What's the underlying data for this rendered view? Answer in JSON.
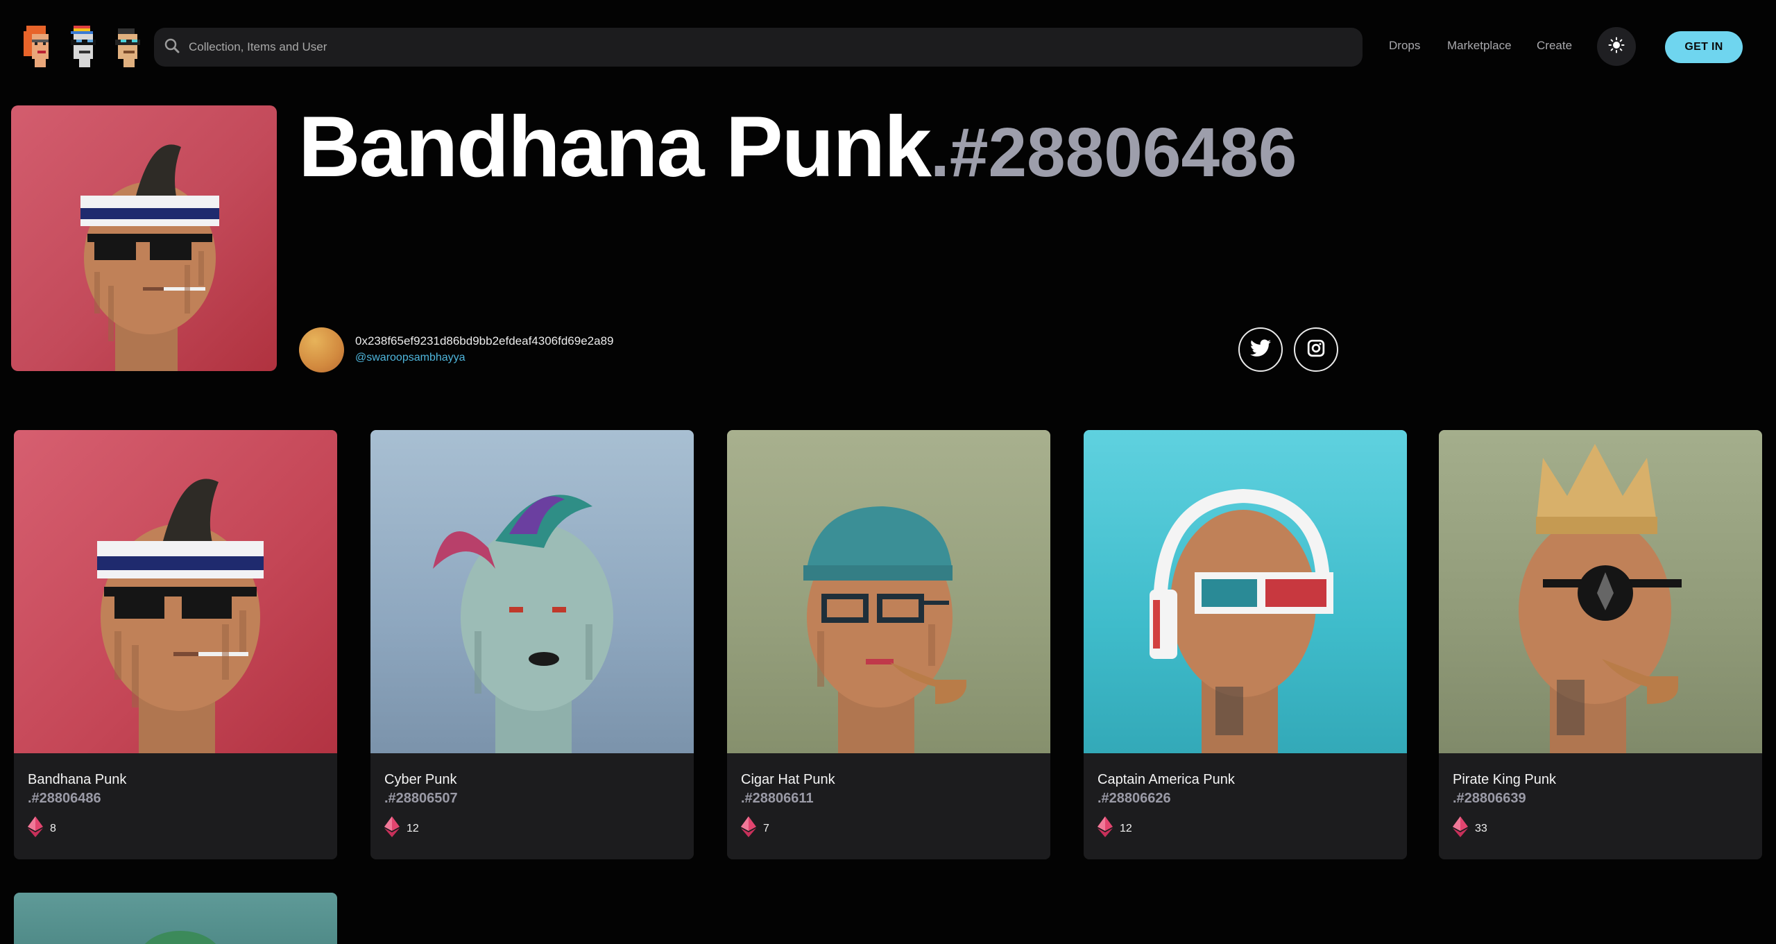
{
  "header": {
    "logos": [
      "punk-logo-orange",
      "punk-logo-cap",
      "punk-logo-shades"
    ],
    "search_placeholder": "Collection, Items and User",
    "nav": [
      "Drops",
      "Marketplace",
      "Create"
    ],
    "theme_icon": "sun-icon",
    "get_in_label": "GET IN"
  },
  "hero": {
    "name": "Bandhana Punk",
    "dot": ".",
    "number": "#28806486",
    "owner_address": "0x238f65ef9231d86bd9bb2efdeaf4306fd69e2a89",
    "owner_handle": "@swaroopsambhayya",
    "social": [
      "twitter-icon",
      "instagram-icon"
    ]
  },
  "items": [
    {
      "name": "Bandhana Punk",
      "id": ".#28806486",
      "price": "8"
    },
    {
      "name": "Cyber Punk",
      "id": ".#28806507",
      "price": "12"
    },
    {
      "name": "Cigar Hat Punk",
      "id": ".#28806611",
      "price": "7"
    },
    {
      "name": "Captain America Punk",
      "id": ".#28806626",
      "price": "12"
    },
    {
      "name": "Pirate King Punk",
      "id": ".#28806639",
      "price": "33"
    }
  ],
  "colors": {
    "background": "#030303",
    "surface": "#1c1c1e",
    "accent": "#6fd5ef",
    "link": "#4fb6dc",
    "muted": "#9d9eab",
    "eth": "#e2456f"
  }
}
